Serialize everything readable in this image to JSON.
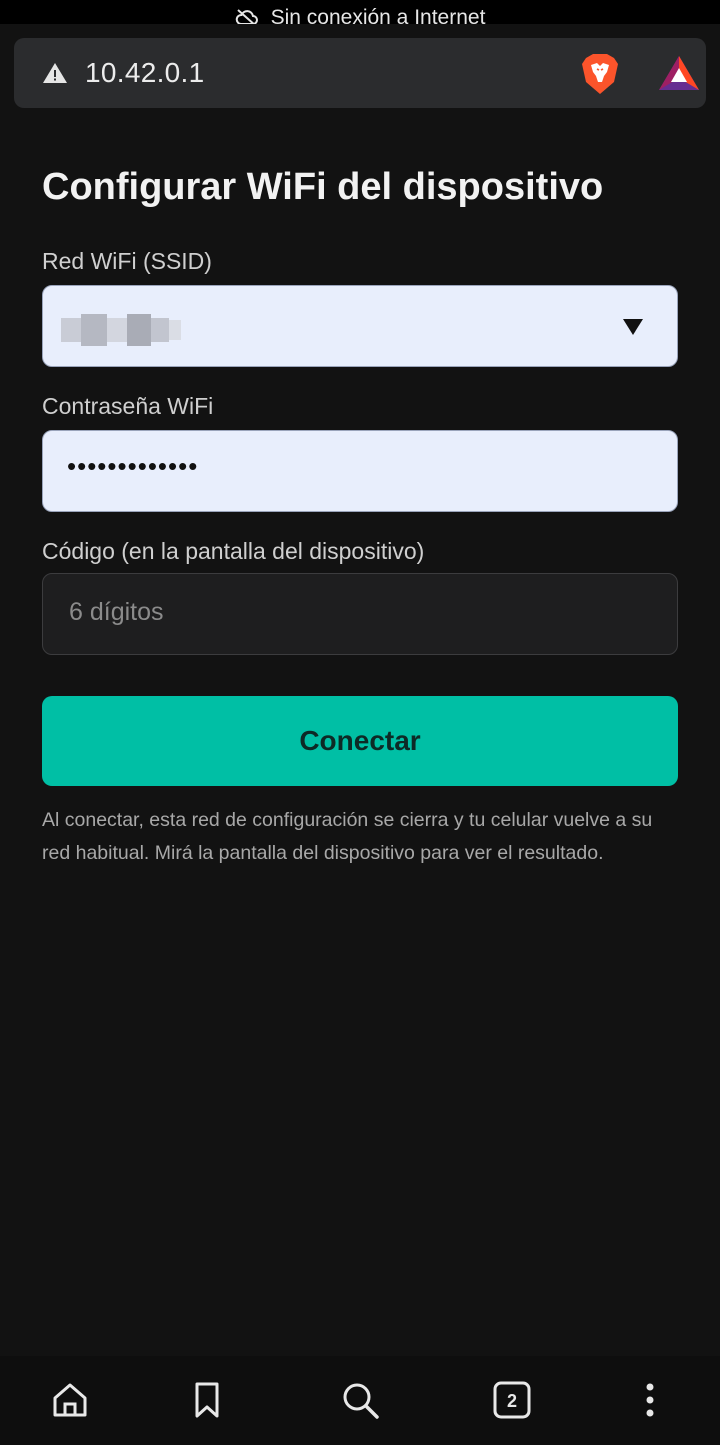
{
  "status_bar": {
    "text": "Sin conexión a Internet",
    "icon": "cloud-off-icon"
  },
  "address_bar": {
    "url": "10.42.0.1",
    "security_icon": "warning-icon",
    "shield_icon": "brave-shields-icon",
    "rewards_icon": "brave-rewards-icon"
  },
  "form": {
    "title": "Configurar WiFi del dispositivo",
    "ssid_label": "Red WiFi (SSID)",
    "password_label": "Contraseña WiFi",
    "password_value": "•••••••••••••",
    "code_label": "Código (en la pantalla del dispositivo)",
    "code_placeholder": "6 dígitos",
    "submit_label": "Conectar",
    "help_text": "Al conectar, esta red de configuración se cierra y tu celular vuelve a su red habitual. Mirá la pantalla del dispositivo para ver el resultado."
  },
  "bottom_nav": {
    "tab_count": "2",
    "icons": [
      "home-icon",
      "bookmark-icon",
      "search-icon",
      "tabs-icon",
      "menu-icon"
    ]
  },
  "colors": {
    "background": "#121212",
    "accent": "#00bfa5",
    "input_bg": "#e8eefc"
  }
}
